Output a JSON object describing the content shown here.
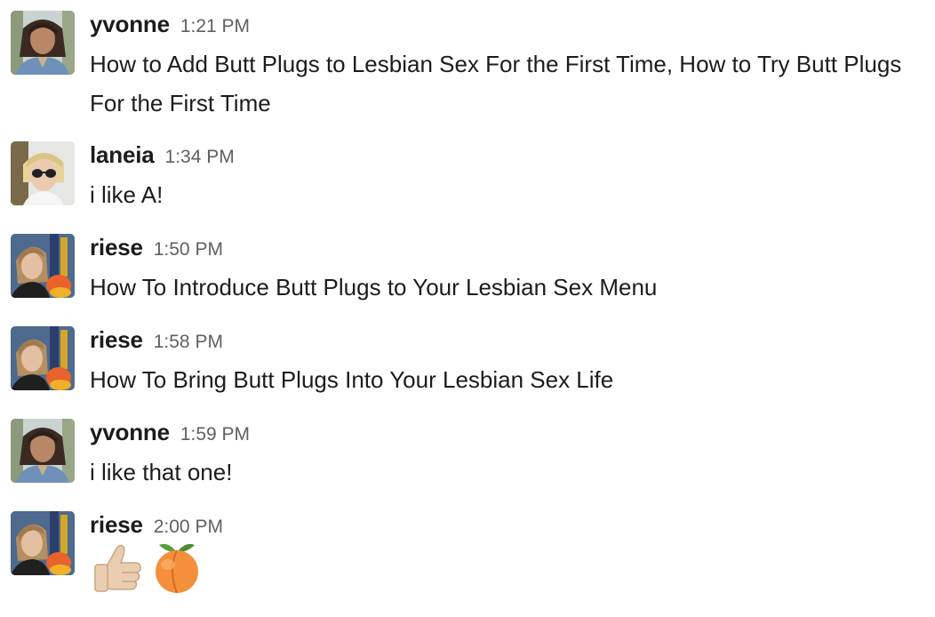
{
  "messages": [
    {
      "author": "yvonne",
      "time": "1:21 PM",
      "text": "How to Add Butt Plugs to Lesbian Sex For the First Time, How to Try Butt Plugs For the First Time",
      "avatar": "yvonne-avatar"
    },
    {
      "author": "laneia",
      "time": "1:34 PM",
      "text": "i like A!",
      "avatar": "laneia-avatar"
    },
    {
      "author": "riese",
      "time": "1:50 PM",
      "text": "How To Introduce Butt Plugs to Your Lesbian Sex Menu",
      "avatar": "riese-avatar"
    },
    {
      "author": "riese",
      "time": "1:58 PM",
      "text": "How To Bring Butt Plugs Into Your Lesbian Sex Life",
      "avatar": "riese-avatar"
    },
    {
      "author": "yvonne",
      "time": "1:59 PM",
      "text": "i like that one!",
      "avatar": "yvonne-avatar"
    },
    {
      "author": "riese",
      "time": "2:00 PM",
      "emojis": [
        "thumbs-up-icon",
        "peach-icon"
      ],
      "avatar": "riese-avatar"
    }
  ]
}
